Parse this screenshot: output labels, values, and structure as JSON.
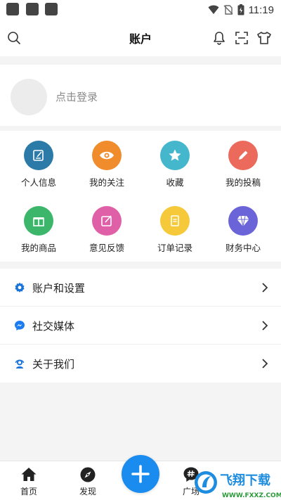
{
  "status_bar": {
    "time": "11:19"
  },
  "header": {
    "title": "账户"
  },
  "login": {
    "prompt": "点击登录"
  },
  "grid": [
    {
      "label": "个人信息",
      "icon": "edit-icon",
      "color": "#2b7aa8"
    },
    {
      "label": "我的关注",
      "icon": "eye-icon",
      "color": "#f08c2c"
    },
    {
      "label": "收藏",
      "icon": "star-icon",
      "color": "#45b7cc"
    },
    {
      "label": "我的投稿",
      "icon": "pencil-icon",
      "color": "#eb6a5c"
    },
    {
      "label": "我的商品",
      "icon": "gift-icon",
      "color": "#3cb66a"
    },
    {
      "label": "意见反馈",
      "icon": "feedback-icon",
      "color": "#e060a8"
    },
    {
      "label": "订单记录",
      "icon": "receipt-icon",
      "color": "#f5c93a"
    },
    {
      "label": "财务中心",
      "icon": "diamond-icon",
      "color": "#6a64d8"
    }
  ],
  "menu": [
    {
      "label": "账户和设置",
      "icon": "gear-icon"
    },
    {
      "label": "社交媒体",
      "icon": "messenger-icon"
    },
    {
      "label": "关于我们",
      "icon": "support-icon"
    }
  ],
  "tabbar": [
    {
      "label": "首页",
      "icon": "home-icon"
    },
    {
      "label": "发现",
      "icon": "compass-icon"
    },
    {
      "label": "广场",
      "icon": "hashtag-icon"
    }
  ],
  "colors": {
    "accent": "#1a8cf0"
  },
  "watermark": {
    "text": "飞翔下载",
    "url_text": "WWW.FXXZ.COM"
  }
}
